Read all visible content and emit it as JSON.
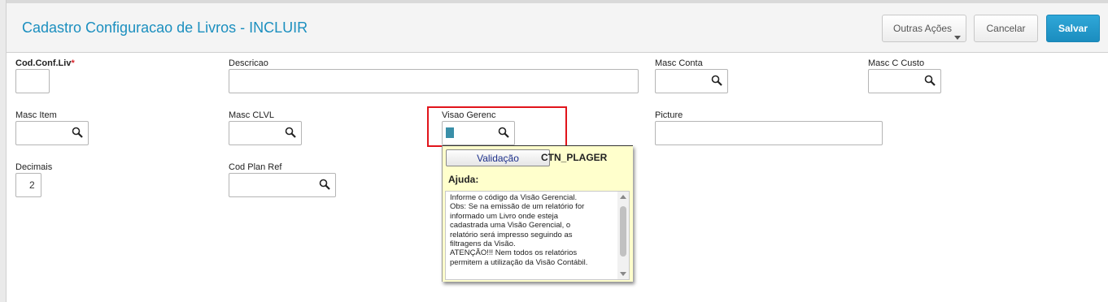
{
  "header": {
    "title": "Cadastro Configuracao de Livros - INCLUIR",
    "buttons": {
      "outras": "Outras Ações",
      "cancel": "Cancelar",
      "save": "Salvar"
    }
  },
  "form": {
    "cod_conf_liv": {
      "label": "Cod.Conf.Liv",
      "required_mark": "*",
      "value": ""
    },
    "descricao": {
      "label": "Descricao",
      "value": ""
    },
    "masc_conta": {
      "label": "Masc Conta",
      "value": ""
    },
    "masc_c_custo": {
      "label": "Masc C Custo",
      "value": ""
    },
    "masc_item": {
      "label": "Masc Item",
      "value": ""
    },
    "masc_clvl": {
      "label": "Masc CLVL",
      "value": ""
    },
    "visao_gerenc": {
      "label": "Visao Gerenc",
      "value": ""
    },
    "picture": {
      "label": "Picture",
      "value": ""
    },
    "decimais": {
      "label": "Decimais",
      "value": "2"
    },
    "cod_plan_ref": {
      "label": "Cod Plan Ref",
      "value": ""
    }
  },
  "help_popup": {
    "validation_button": "Validação",
    "code": "CTN_PLAGER",
    "title": "Ajuda:",
    "lines": [
      "Informe o código da Visão Gerencial.",
      "Obs: Se na emissão de um relatório for",
      "informado um Livro onde esteja",
      "cadastrada uma Visão Gerencial, o",
      "relatório será impresso seguindo as",
      "filtragens da Visão.",
      "ATENÇÃO!!! Nem todos os relatórios",
      "permitem a utilização da Visão Contábil."
    ]
  },
  "colors": {
    "accent": "#1b8fbf",
    "save_button": "#2fa7d8",
    "required": "#d9262d",
    "highlight": "#e1141b",
    "popup_bg": "#ffffcc"
  }
}
